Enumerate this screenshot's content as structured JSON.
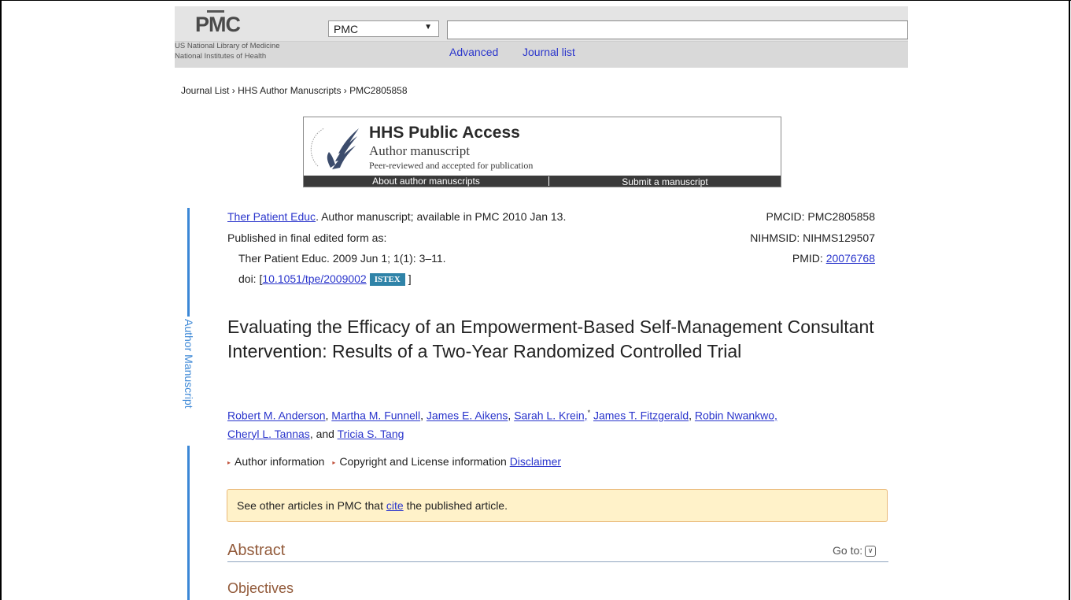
{
  "header": {
    "logo_text": "PMC",
    "nlm_line1": "US National Library of Medicine",
    "nlm_line2": "National Institutes of Health",
    "database_selected": "PMC",
    "search_value": "",
    "advanced_link": "Advanced",
    "journal_list_link": "Journal list"
  },
  "breadcrumb": {
    "item1": "Journal List",
    "item2": "HHS Author Manuscripts",
    "item3": "PMC2805858",
    "separator": "›"
  },
  "hhs_banner": {
    "title": "HHS Public Access",
    "subtitle": "Author manuscript",
    "note": "Peer-reviewed and accepted for publication",
    "about_button": "About author manuscripts",
    "submit_button": "Submit a manuscript"
  },
  "side_label": "Author Manuscript",
  "citation": {
    "journal_link": "Ther Patient Educ",
    "availability": ". Author manuscript; available in PMC 2010 Jan 13.",
    "published_label": "Published in final edited form as:",
    "published_ref": "Ther Patient Educ. 2009 Jun 1; 1(1): 3–11.",
    "doi_label": "doi:",
    "doi_open": "[",
    "doi_value": "10.1051/tpe/2009002",
    "istex_badge": "ISTEX",
    "doi_close": "]",
    "pmcid": "PMCID: PMC2805858",
    "nihmsid": "NIHMSID: NIHMS129507",
    "pmid_label": "PMID:",
    "pmid_value": "20076768"
  },
  "article": {
    "title": "Evaluating the Efficacy of an Empowerment-Based Self-Management Consultant Intervention: Results of a Two-Year Randomized Controlled Trial",
    "authors": [
      "Robert M. Anderson",
      "Martha M. Funnell",
      "James E. Aikens",
      "Sarah L. Krein,",
      "James T. Fitzgerald",
      "Robin Nwankwo,",
      "Cheryl L. Tannas",
      "Tricia S. Tang"
    ],
    "author_sep": ", ",
    "author_and": ", and ",
    "asterisk": "*"
  },
  "info": {
    "author_information": "Author information",
    "copyright": "Copyright and License information",
    "disclaimer": "Disclaimer"
  },
  "notice": {
    "prefix": "See other articles in PMC that",
    "link": "cite",
    "suffix": "the published article."
  },
  "abstract": {
    "heading": "Abstract",
    "goto_label": "Go to:",
    "goto_icon": "chevron-down",
    "objectives": "Objectives"
  },
  "colors": {
    "link": "#2a35cc",
    "accent_blue": "#3b87d6",
    "heading_brown": "#925a3a",
    "notice_bg": "#fff2c9"
  }
}
